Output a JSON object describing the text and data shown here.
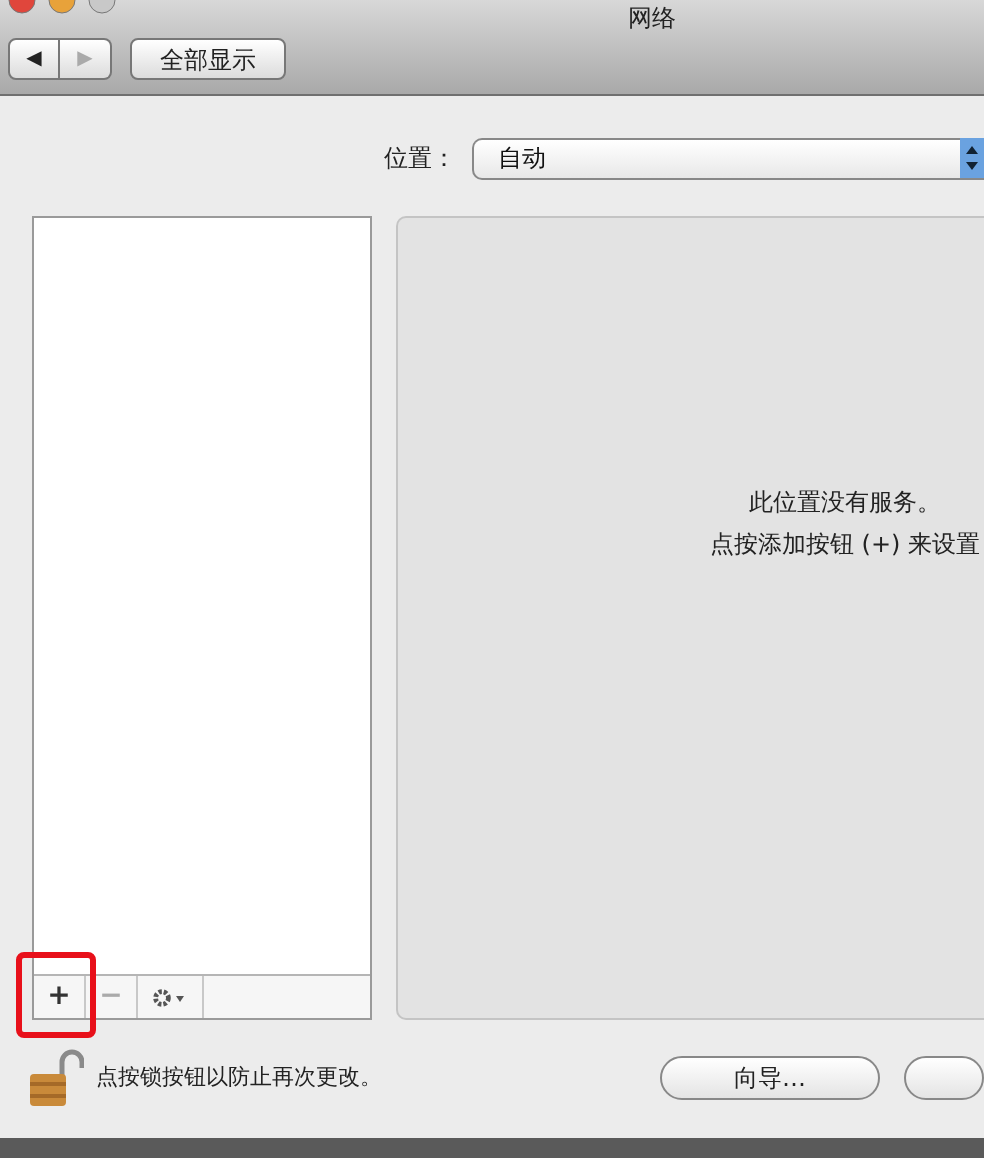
{
  "window": {
    "title": "网络"
  },
  "nav": [
    {
      "glyph": "◀",
      "disabled": false
    },
    {
      "glyph": "▶",
      "disabled": true
    }
  ],
  "show_all": "全部显示",
  "location": {
    "label": "位置：",
    "value": "自动"
  },
  "service_buttons": [
    {
      "kind": "add",
      "glyph": "+",
      "disabled": false,
      "highlighted": true
    },
    {
      "kind": "remove",
      "glyph": "−",
      "disabled": true,
      "highlighted": false
    },
    {
      "kind": "gear",
      "disabled": false,
      "highlighted": false
    }
  ],
  "empty_message": [
    "此位置没有服务。",
    "点按添加按钮 (+) 来设置"
  ],
  "lock": {
    "locked": false,
    "message": "点按锁按钮以防止再次更改。"
  },
  "assistant_button": "向导…"
}
